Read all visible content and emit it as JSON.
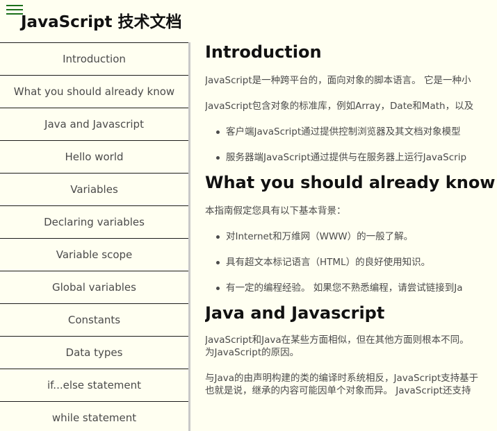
{
  "header": {
    "menu_icon": "hamburger-menu-icon",
    "title": "JavaScript 技术文档"
  },
  "sidebar": {
    "items": [
      {
        "label": "Introduction"
      },
      {
        "label": "What you should already know"
      },
      {
        "label": "Java and Javascript"
      },
      {
        "label": "Hello world"
      },
      {
        "label": "Variables"
      },
      {
        "label": "Declaring variables"
      },
      {
        "label": "Variable scope"
      },
      {
        "label": "Global variables"
      },
      {
        "label": "Constants"
      },
      {
        "label": "Data types"
      },
      {
        "label": "if...else statement"
      },
      {
        "label": "while statement"
      }
    ]
  },
  "main": {
    "sections": [
      {
        "title": "Introduction",
        "paragraphs": [
          "JavaScript是一种跨平台的，面向对象的脚本语言。 它是一种小",
          "JavaScript包含对象的标准库，例如Array，Date和Math，以及"
        ],
        "bullets": [
          "客户端JavaScript通过提供控制浏览器及其文档对象模型",
          "服务器端JavaScript通过提供与在服务器上运行JavaScrip"
        ]
      },
      {
        "title": "What you should already know",
        "paragraphs": [
          "本指南假定您具有以下基本背景："
        ],
        "bullets": [
          "对Internet和万维网（WWW）的一般了解。",
          "具有超文本标记语言（HTML）的良好使用知识。",
          "有一定的编程经验。 如果您不熟悉编程，请尝试链接到Ja"
        ]
      },
      {
        "title": "Java and Javascript",
        "paragraphs": [
          "JavaScript和Java在某些方面相似，但在其他方面则根本不同。",
          "为JavaScript的原因。",
          "与Java的由声明构建的类的编译时系统相反，JavaScript支持基于",
          "也就是说，继承的内容可能因单个对象而异。 JavaScript还支持"
        ]
      }
    ]
  }
}
